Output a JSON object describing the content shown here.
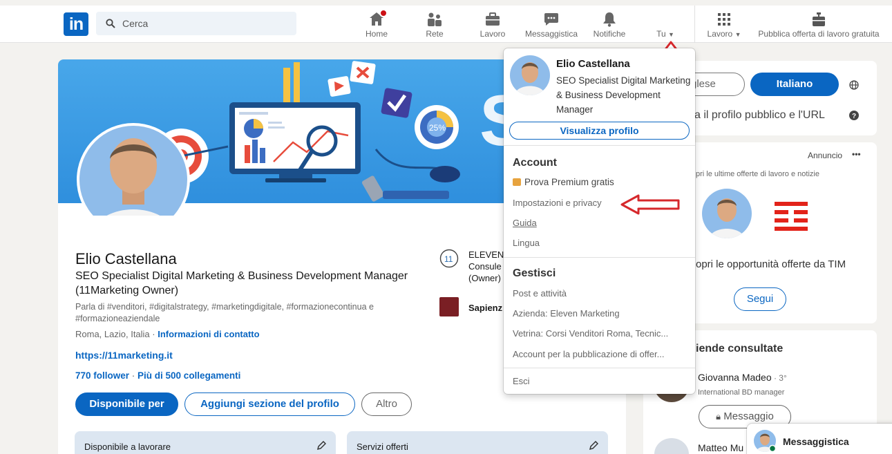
{
  "nav": {
    "search_placeholder": "Cerca",
    "items": [
      {
        "label": "Home",
        "icon": "home-icon"
      },
      {
        "label": "Rete",
        "icon": "network-icon"
      },
      {
        "label": "Lavoro",
        "icon": "briefcase-icon"
      },
      {
        "label": "Messaggistica",
        "icon": "chat-icon"
      },
      {
        "label": "Notifiche",
        "icon": "bell-icon"
      },
      {
        "label": "Tu",
        "icon": "avatar"
      },
      {
        "label": "Lavoro",
        "icon": "grid-icon"
      },
      {
        "label": "Pubblica offerta di lavoro gratuita",
        "icon": "post-job-icon"
      }
    ]
  },
  "profile": {
    "name": "Elio Castellana",
    "headline": "SEO Specialist Digital Marketing & Business Development Manager (11Marketing Owner)",
    "about": "Parla di #venditori, #digitalstrategy, #marketingdigitale, #formazionecontinua e #formazioneaziendale",
    "location": "Roma, Lazio, Italia",
    "location_sep": " · ",
    "contact_link": "Informazioni di contatto",
    "website": "https://11marketing.it",
    "followers": "770 follower",
    "connections_sep": " · ",
    "connections": "Più di 500 collegamenti",
    "btn_available": "Disponibile per",
    "btn_add_section": "Aggiungi sezione del profilo",
    "btn_more": "Altro",
    "experience": [
      {
        "line1": "ELEVEN",
        "line2": "Consule",
        "line3": "(Owner)"
      },
      {
        "line1": "Sapienz"
      }
    ],
    "open_to_work": "Disponibile a lavorare",
    "services": "Servizi offerti"
  },
  "banner": {
    "percent_label": "25%"
  },
  "right": {
    "lang_other": "glese",
    "lang_active": "Italiano",
    "public_profile": "a il profilo pubblico e l'URL",
    "ad_label": "Annuncio",
    "ad_more": "•••",
    "ad_text": "pri le ultime offerte di lavoro e notizie",
    "ad_tagline": "opri le opportunità offerte da TIM",
    "follow": "Segui",
    "companies_title": "iende consultate",
    "person1_name": "Giovanna Madeo",
    "person1_degree": " · 3°",
    "person1_role": "International BD manager",
    "message_btn": "Messaggio",
    "person2_name": "Matteo Mu"
  },
  "dropdown": {
    "name": "Elio Castellana",
    "headline": "SEO Specialist Digital Marketing & Business Development Manager",
    "view_profile": "Visualizza profilo",
    "account_title": "Account",
    "premium": "Prova Premium gratis",
    "settings": "Impostazioni e privacy",
    "help": "Guida",
    "language": "Lingua",
    "manage_title": "Gestisci",
    "posts": "Post e attività",
    "company": "Azienda: Eleven Marketing",
    "showcase": "Vetrina: Corsi Venditori Roma, Tecnic...",
    "job_account": "Account per la pubblicazione di offer...",
    "logout": "Esci"
  },
  "messaging": {
    "label": "Messaggistica"
  },
  "colors": {
    "brand": "#0a66c2",
    "annotation": "#d6282c",
    "tim_red": "#e2231a"
  }
}
